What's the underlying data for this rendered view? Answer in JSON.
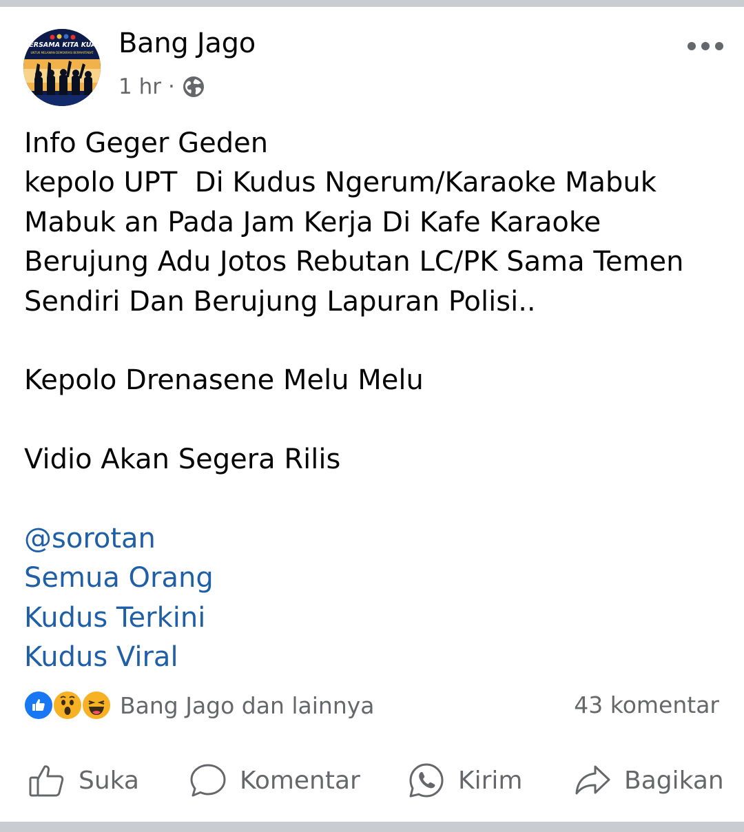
{
  "post": {
    "author": "Bang Jago",
    "time": "1 hr",
    "separator": "·",
    "avatar_text": {
      "headline": "BERSAMA KITA KUAT",
      "subline": "UNTUK MELAWAN DEMOKRASI BERMARTABAT"
    },
    "body_lines": [
      "Info Geger Geden",
      "kepolo UPT  Di Kudus Ngerum/Karaoke Mabuk",
      "Mabuk an Pada Jam Kerja Di Kafe Karaoke",
      "Berujung Adu Jotos Rebutan LC/PK Sama Temen",
      "Sendiri Dan Berujung Lapuran Polisi..",
      "",
      "Kepolo Drenasene Melu Melu",
      "",
      "Vidio Akan Segera Rilis",
      ""
    ],
    "tags": [
      "@sorotan",
      "Semua Orang",
      "Kudus Terkini",
      "Kudus Viral"
    ],
    "reactions": {
      "icons": [
        "like-icon",
        "wow-icon",
        "haha-icon"
      ],
      "label": "Bang Jago dan lainnya"
    },
    "comments": "43 komentar"
  },
  "actions": {
    "like": "Suka",
    "comment": "Komentar",
    "send": "Kirim",
    "share": "Bagikan"
  },
  "colors": {
    "link": "#1e5fa8",
    "secondary_text": "#65676b",
    "like_blue": "#1877f2",
    "emoji_yellow": "#f7b125"
  }
}
